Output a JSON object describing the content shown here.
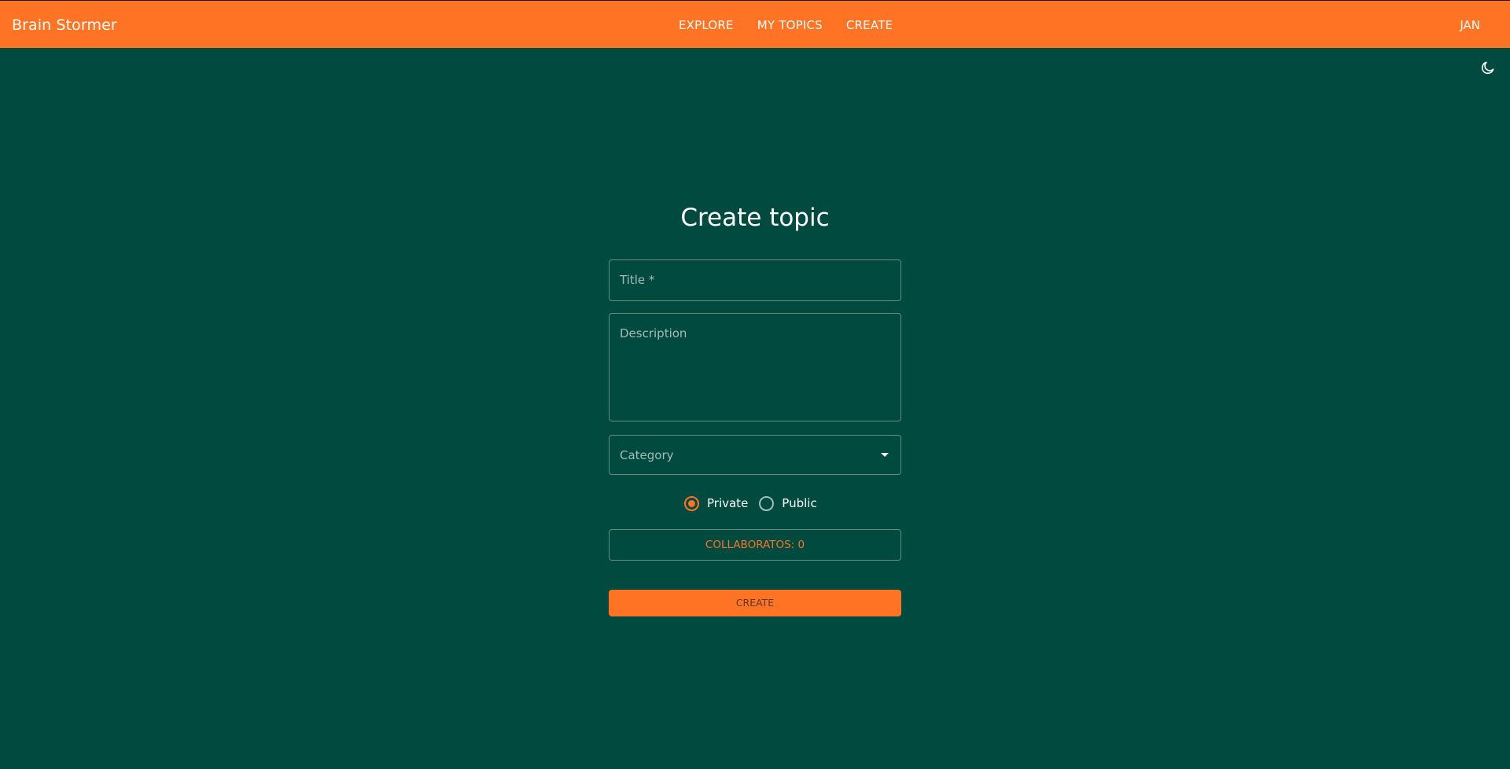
{
  "app": {
    "title": "Brain Stormer"
  },
  "nav": {
    "items": [
      {
        "label": "EXPLORE"
      },
      {
        "label": "MY TOPICS"
      },
      {
        "label": "CREATE"
      }
    ],
    "user_label": "JAN"
  },
  "theme_toggle": {
    "icon": "moon-icon"
  },
  "form": {
    "heading": "Create topic",
    "title_field": {
      "label": "Title *",
      "value": ""
    },
    "description_field": {
      "label": "Description",
      "value": ""
    },
    "category_field": {
      "label": "Category",
      "value": ""
    },
    "visibility": {
      "options": [
        {
          "label": "Private",
          "checked": true
        },
        {
          "label": "Public",
          "checked": false
        }
      ]
    },
    "collaborators_button": "COLLABORATOS: 0",
    "submit_button": "CREATE"
  },
  "colors": {
    "accent": "#ff7324",
    "background": "#004a40"
  }
}
